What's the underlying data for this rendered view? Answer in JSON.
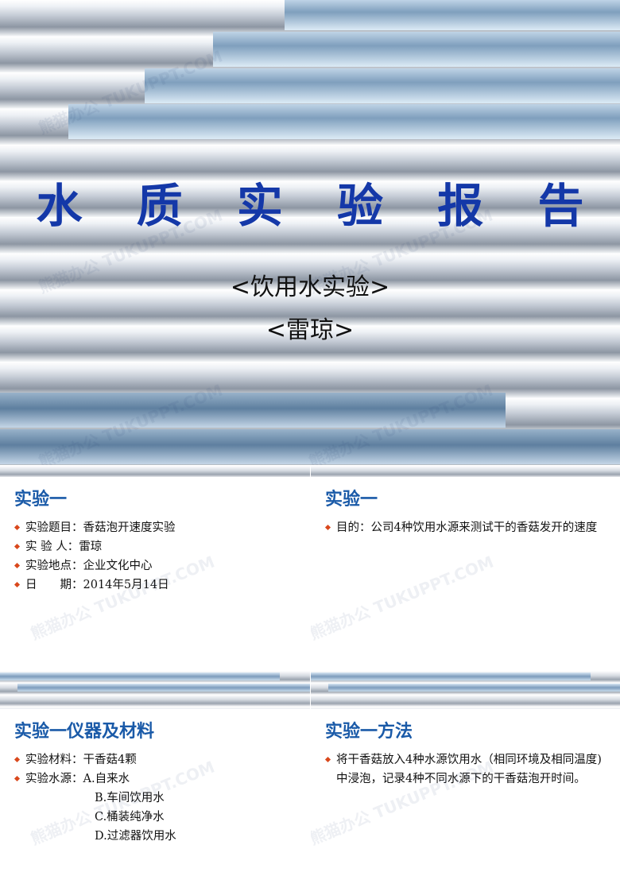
{
  "title_slide": {
    "title": "水 质 实 验 报 告",
    "subtitle_1": "<饮用水实验>",
    "subtitle_2": "<雷琼>",
    "accent_color": "#1438a8"
  },
  "watermark": "熊猫办公 TUKUPPT.COM",
  "slides": [
    {
      "heading": "实验一",
      "bullets": [
        "实验题目：香菇泡开速度实验",
        "实 验 人：雷琼",
        "实验地点：企业文化中心",
        "日　　期：2014年5月14日"
      ]
    },
    {
      "heading": "实验一",
      "bullets": [
        "目的：公司4种饮用水源来测试干的香菇发开的速度"
      ]
    },
    {
      "heading": "实验一仪器及材料",
      "bullets": [
        "实验材料：干香菇4颗",
        "实验水源：A.自来水"
      ],
      "continuation": [
        "B.车间饮用水",
        "C.桶装纯净水",
        "D.过滤器饮用水"
      ]
    },
    {
      "heading": "实验一方法",
      "bullets": [
        "将干香菇放入4种水源饮用水（相同环境及相同温度)中浸泡，记录4种不同水源下的干香菇泡开时间。"
      ]
    }
  ],
  "colors": {
    "heading": "#1a5aa8",
    "bullet": "#d9481c"
  }
}
